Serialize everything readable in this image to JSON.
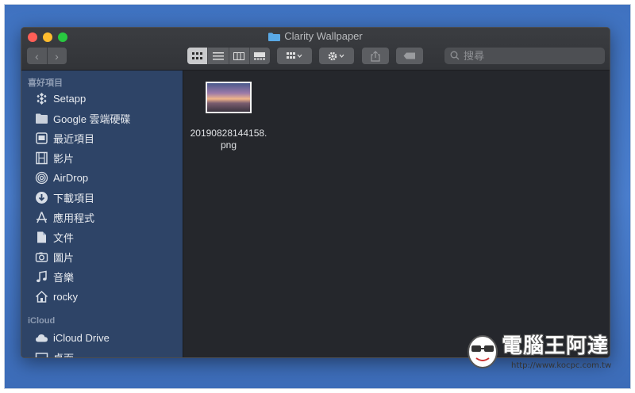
{
  "window": {
    "title": "Clarity Wallpaper"
  },
  "toolbar": {
    "back_label": "‹",
    "forward_label": "›",
    "search_placeholder": "搜尋"
  },
  "sidebar": {
    "favorites_header": "喜好項目",
    "items": [
      {
        "label": "Setapp",
        "icon": "setapp-icon"
      },
      {
        "label": "Google 雲端硬碟",
        "icon": "folder-icon"
      },
      {
        "label": "最近項目",
        "icon": "recents-icon"
      },
      {
        "label": "影片",
        "icon": "film-icon"
      },
      {
        "label": "AirDrop",
        "icon": "airdrop-icon"
      },
      {
        "label": "下載項目",
        "icon": "download-icon"
      },
      {
        "label": "應用程式",
        "icon": "applications-icon"
      },
      {
        "label": "文件",
        "icon": "document-icon"
      },
      {
        "label": "圖片",
        "icon": "camera-icon"
      },
      {
        "label": "音樂",
        "icon": "music-icon"
      },
      {
        "label": "rocky",
        "icon": "home-icon"
      }
    ],
    "icloud_header": "iCloud",
    "icloud_items": [
      {
        "label": "iCloud Drive",
        "icon": "cloud-icon"
      },
      {
        "label": "桌面",
        "icon": "desktop-icon"
      }
    ]
  },
  "content": {
    "files": [
      {
        "name_line1": "20190828144158.",
        "name_line2": "png"
      }
    ]
  },
  "watermark": {
    "text": "電腦王阿達",
    "url": "http://www.kocpc.com.tw"
  },
  "colors": {
    "sidebar_bg": "#2e4467",
    "content_bg": "#25272c",
    "accent_folder": "#5aa9e6"
  }
}
